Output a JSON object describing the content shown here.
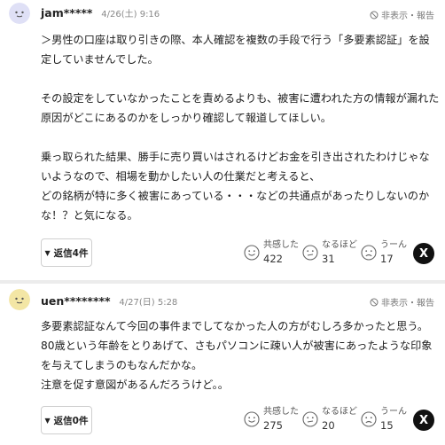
{
  "comments": [
    {
      "username": "jam*****",
      "timestamp": "4/26(土) 9:16",
      "report_label": "非表示・報告",
      "avatar_color": "#dfe0f6",
      "paragraphs": [
        "＞男性の口座は取り引きの際、本人確認を複数の手段で行う「多要素認証」を設定していませんでした。",
        "",
        "その設定をしていなかったことを責めるよりも、被害に遭われた方の情報が漏れた原因がどこにあるのかをしっかり確認して報道してほしい。",
        "",
        "乗っ取られた結果、勝手に売り買いはされるけどお金を引き出されたわけじゃないようなので、相場を動かしたい人の仕業だと考えると、",
        "どの銘柄が特に多く被害にあっている・・・などの共通点があったりしないのかな！？と気になる。"
      ],
      "reply_label": "返信4件",
      "reactions": [
        {
          "label": "共感した",
          "count": "422",
          "icon": "smile-icon"
        },
        {
          "label": "なるほど",
          "count": "31",
          "icon": "thinking-icon"
        },
        {
          "label": "うーん",
          "count": "17",
          "icon": "frown-icon"
        }
      ],
      "share_label": "X"
    },
    {
      "username": "uen********",
      "timestamp": "4/27(日) 5:28",
      "report_label": "非表示・報告",
      "avatar_color": "#f3e6a5",
      "paragraphs": [
        "多要素認証なんて今回の事件までしてなかった人の方がむしろ多かったと思う。80歳という年齢をとりあげて、さもパソコンに疎い人が被害にあったような印象を与えてしまうのもなんだかな。",
        "注意を促す意図があるんだろうけど。。"
      ],
      "reply_label": "返信0件",
      "reactions": [
        {
          "label": "共感した",
          "count": "275",
          "icon": "smile-icon"
        },
        {
          "label": "なるほど",
          "count": "20",
          "icon": "thinking-icon"
        },
        {
          "label": "うーん",
          "count": "15",
          "icon": "frown-icon"
        }
      ],
      "share_label": "X"
    }
  ]
}
